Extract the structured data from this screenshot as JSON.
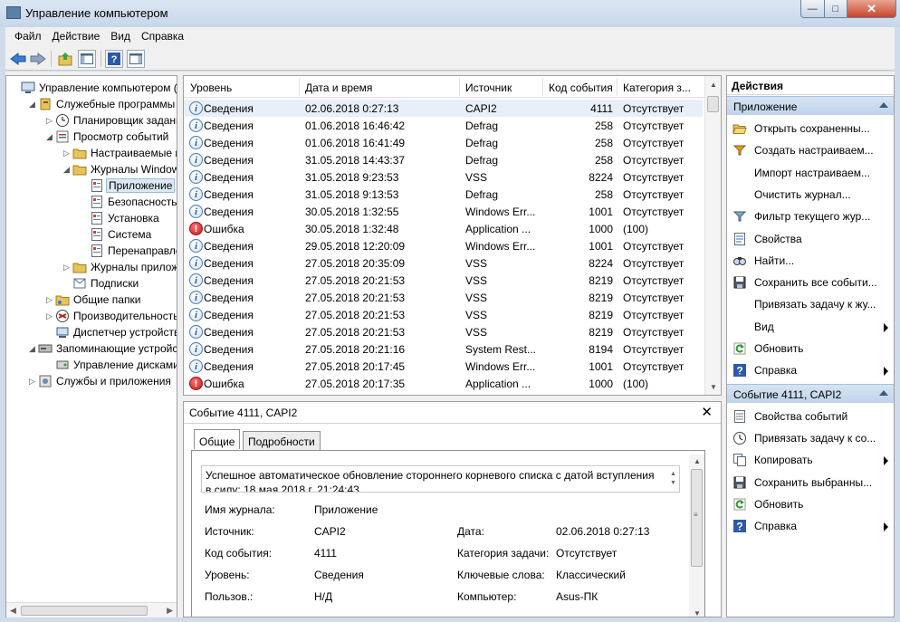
{
  "window": {
    "title": "Управление компьютером"
  },
  "menu": [
    "Файл",
    "Действие",
    "Вид",
    "Справка"
  ],
  "tree": [
    {
      "label": "Управление компьютером (л",
      "icon": "computer-icon",
      "expander": "",
      "depth": 0
    },
    {
      "label": "Служебные программы",
      "icon": "tools-icon",
      "expander": "down",
      "depth": 1
    },
    {
      "label": "Планировщик заданий",
      "icon": "clock-icon",
      "expander": "right",
      "depth": 2
    },
    {
      "label": "Просмотр событий",
      "icon": "event-viewer-icon",
      "expander": "down",
      "depth": 2
    },
    {
      "label": "Настраиваемые пр",
      "icon": "folder-icon",
      "expander": "right",
      "depth": 3
    },
    {
      "label": "Журналы Windows",
      "icon": "folder-icon",
      "expander": "down",
      "depth": 3
    },
    {
      "label": "Приложение",
      "icon": "log-icon",
      "expander": "",
      "depth": 4,
      "selected": true
    },
    {
      "label": "Безопасность",
      "icon": "log-icon",
      "expander": "",
      "depth": 4
    },
    {
      "label": "Установка",
      "icon": "log-icon",
      "expander": "",
      "depth": 4
    },
    {
      "label": "Система",
      "icon": "log-icon",
      "expander": "",
      "depth": 4
    },
    {
      "label": "Перенаправлен",
      "icon": "log-icon",
      "expander": "",
      "depth": 4
    },
    {
      "label": "Журналы приложе",
      "icon": "folder-icon",
      "expander": "right",
      "depth": 3
    },
    {
      "label": "Подписки",
      "icon": "subscription-icon",
      "expander": "",
      "depth": 3
    },
    {
      "label": "Общие папки",
      "icon": "shared-folder-icon",
      "expander": "right",
      "depth": 2
    },
    {
      "label": "Производительность",
      "icon": "performance-icon",
      "expander": "right",
      "depth": 2
    },
    {
      "label": "Диспетчер устройств",
      "icon": "device-manager-icon",
      "expander": "",
      "depth": 2
    },
    {
      "label": "Запоминающие устройст",
      "icon": "storage-icon",
      "expander": "down",
      "depth": 1
    },
    {
      "label": "Управление дисками",
      "icon": "disk-icon",
      "expander": "",
      "depth": 2
    },
    {
      "label": "Службы и приложения",
      "icon": "services-icon",
      "expander": "right",
      "depth": 1
    }
  ],
  "events": {
    "columns": [
      "Уровень",
      "Дата и время",
      "Источник",
      "Код события",
      "Категория з..."
    ],
    "rows": [
      {
        "level": "Сведения",
        "type": "info",
        "date": "02.06.2018 0:27:13",
        "source": "CAPI2",
        "id": "4111",
        "category": "Отсутствует",
        "selected": true
      },
      {
        "level": "Сведения",
        "type": "info",
        "date": "01.06.2018 16:46:42",
        "source": "Defrag",
        "id": "258",
        "category": "Отсутствует"
      },
      {
        "level": "Сведения",
        "type": "info",
        "date": "01.06.2018 16:41:49",
        "source": "Defrag",
        "id": "258",
        "category": "Отсутствует"
      },
      {
        "level": "Сведения",
        "type": "info",
        "date": "31.05.2018 14:43:37",
        "source": "Defrag",
        "id": "258",
        "category": "Отсутствует"
      },
      {
        "level": "Сведения",
        "type": "info",
        "date": "31.05.2018 9:23:53",
        "source": "VSS",
        "id": "8224",
        "category": "Отсутствует"
      },
      {
        "level": "Сведения",
        "type": "info",
        "date": "31.05.2018 9:13:53",
        "source": "Defrag",
        "id": "258",
        "category": "Отсутствует"
      },
      {
        "level": "Сведения",
        "type": "info",
        "date": "30.05.2018 1:32:55",
        "source": "Windows Err...",
        "id": "1001",
        "category": "Отсутствует"
      },
      {
        "level": "Ошибка",
        "type": "error",
        "date": "30.05.2018 1:32:48",
        "source": "Application ...",
        "id": "1000",
        "category": "(100)"
      },
      {
        "level": "Сведения",
        "type": "info",
        "date": "29.05.2018 12:20:09",
        "source": "Windows Err...",
        "id": "1001",
        "category": "Отсутствует"
      },
      {
        "level": "Сведения",
        "type": "info",
        "date": "27.05.2018 20:35:09",
        "source": "VSS",
        "id": "8224",
        "category": "Отсутствует"
      },
      {
        "level": "Сведения",
        "type": "info",
        "date": "27.05.2018 20:21:53",
        "source": "VSS",
        "id": "8219",
        "category": "Отсутствует"
      },
      {
        "level": "Сведения",
        "type": "info",
        "date": "27.05.2018 20:21:53",
        "source": "VSS",
        "id": "8219",
        "category": "Отсутствует"
      },
      {
        "level": "Сведения",
        "type": "info",
        "date": "27.05.2018 20:21:53",
        "source": "VSS",
        "id": "8219",
        "category": "Отсутствует"
      },
      {
        "level": "Сведения",
        "type": "info",
        "date": "27.05.2018 20:21:53",
        "source": "VSS",
        "id": "8219",
        "category": "Отсутствует"
      },
      {
        "level": "Сведения",
        "type": "info",
        "date": "27.05.2018 20:21:16",
        "source": "System Rest...",
        "id": "8194",
        "category": "Отсутствует"
      },
      {
        "level": "Сведения",
        "type": "info",
        "date": "27.05.2018 20:17:45",
        "source": "Windows Err...",
        "id": "1001",
        "category": "Отсутствует"
      },
      {
        "level": "Ошибка",
        "type": "error",
        "date": "27.05.2018 20:17:35",
        "source": "Application ...",
        "id": "1000",
        "category": "(100)"
      }
    ]
  },
  "details": {
    "title": "Событие 4111, CAPI2",
    "tabs": [
      "Общие",
      "Подробности"
    ],
    "message": "Успешное автоматическое обновление стороннего корневого списка с датой вступления в силу: 18 мая 2018 г. 21:24:43",
    "fields": {
      "log_label": "Имя журнала:",
      "log_value": "Приложение",
      "source_label": "Источник:",
      "source_value": "CAPI2",
      "date_label": "Дата:",
      "date_value": "02.06.2018 0:27:13",
      "id_label": "Код события:",
      "id_value": "4111",
      "task_label": "Категория задачи:",
      "task_value": "Отсутствует",
      "level_label": "Уровень:",
      "level_value": "Сведения",
      "keywords_label": "Ключевые слова:",
      "keywords_value": "Классический",
      "user_label": "Пользов.:",
      "user_value": "Н/Д",
      "computer_label": "Компьютер:",
      "computer_value": "Asus-ПК"
    }
  },
  "actions": {
    "header": "Действия",
    "section1": "Приложение",
    "items1": [
      {
        "label": "Открыть сохраненны...",
        "icon": "open-folder-icon",
        "submenu": false
      },
      {
        "label": "Создать настраиваем...",
        "icon": "filter-create-icon",
        "submenu": false
      },
      {
        "label": "Импорт настраиваем...",
        "icon": "",
        "submenu": false
      },
      {
        "label": "Очистить журнал...",
        "icon": "",
        "submenu": false
      },
      {
        "label": "Фильтр текущего жур...",
        "icon": "filter-icon",
        "submenu": false
      },
      {
        "label": "Свойства",
        "icon": "properties-icon",
        "submenu": false
      },
      {
        "label": "Найти...",
        "icon": "find-icon",
        "submenu": false
      },
      {
        "label": "Сохранить все событи...",
        "icon": "save-icon",
        "submenu": false
      },
      {
        "label": "Привязать задачу к жу...",
        "icon": "",
        "submenu": false
      },
      {
        "label": "Вид",
        "icon": "",
        "submenu": true
      },
      {
        "label": "Обновить",
        "icon": "refresh-icon",
        "submenu": false
      },
      {
        "label": "Справка",
        "icon": "help-icon",
        "submenu": true
      }
    ],
    "section2": "Событие 4111, CAPI2",
    "items2": [
      {
        "label": "Свойства событий",
        "icon": "event-properties-icon",
        "submenu": false
      },
      {
        "label": "Привязать задачу к со...",
        "icon": "task-icon",
        "submenu": false
      },
      {
        "label": "Копировать",
        "icon": "copy-icon",
        "submenu": true
      },
      {
        "label": "Сохранить выбранны...",
        "icon": "save-icon",
        "submenu": false
      },
      {
        "label": "Обновить",
        "icon": "refresh-icon",
        "submenu": false
      },
      {
        "label": "Справка",
        "icon": "help-icon",
        "submenu": true
      }
    ]
  }
}
